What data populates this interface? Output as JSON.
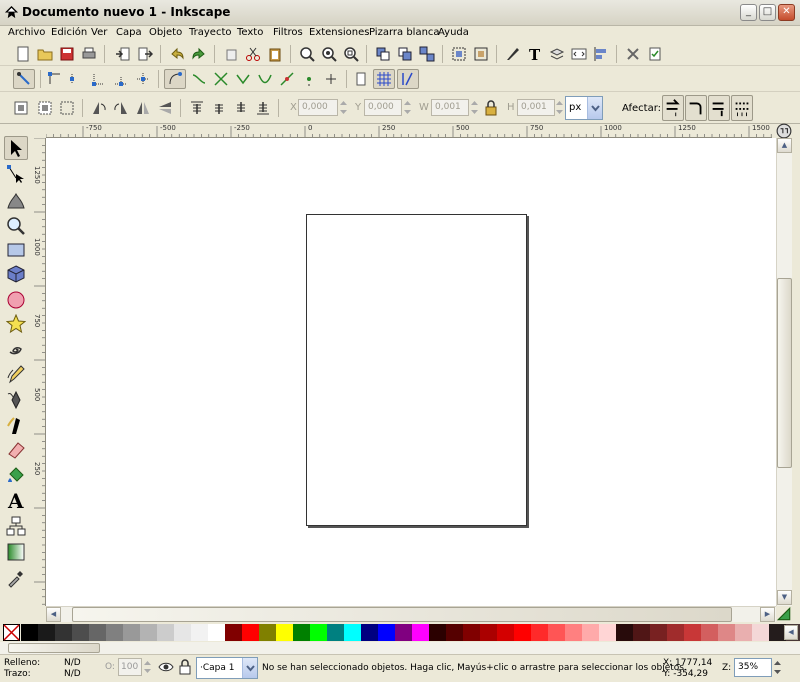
{
  "window": {
    "title": "Documento nuevo 1 - Inkscape",
    "buttons": {
      "minimize": "_",
      "maximize": "□",
      "close": "✕"
    }
  },
  "menubar": {
    "items": [
      "Archivo",
      "Edición",
      "Ver",
      "Capa",
      "Objeto",
      "Trayecto",
      "Texto",
      "Filtros",
      "Extensiones",
      "Pizarra blanca",
      "Ayuda"
    ]
  },
  "toolbar_main": {
    "icons": [
      "new-doc-icon",
      "open-icon",
      "save-icon",
      "print-icon",
      "import-icon",
      "export-icon",
      "undo-icon",
      "redo-icon",
      "duplicate-icon",
      "cut-icon",
      "paste-icon",
      "zoom-selection-icon",
      "zoom-drawing-icon",
      "zoom-page-icon",
      "clone-icon",
      "group-icon",
      "ungroup-icon",
      "fill-stroke-icon",
      "text-font-icon",
      "layers-icon",
      "xml-editor-icon",
      "align-icon",
      "preferences-icon",
      "document-properties-icon"
    ]
  },
  "toolbar_snap": {
    "icons": [
      "snap-toggle-icon",
      "snap-bbox-icon",
      "snap-edges-icon",
      "snap-corners-icon",
      "snap-midpoints-icon",
      "snap-center-icon",
      "snap-nodes-icon",
      "snap-paths-icon",
      "snap-intersections-icon",
      "snap-cusp-icon",
      "snap-smooth-icon",
      "snap-midpoints-path-icon",
      "snap-object-center-icon",
      "snap-rotation-icon",
      "snap-page-icon",
      "snap-grid-icon",
      "snap-guide-icon"
    ]
  },
  "toolbar_tool": {
    "x_label": "X",
    "x_value": "0,000",
    "y_label": "Y",
    "y_value": "0,000",
    "w_label": "W",
    "w_value": "0,001",
    "h_label": "H",
    "h_value": "0,001",
    "unit": "px",
    "affect_label": "Afectar:"
  },
  "tools": [
    "selector-tool-icon",
    "node-tool-icon",
    "tweak-tool-icon",
    "zoom-tool-icon",
    "rectangle-tool-icon",
    "3d-box-tool-icon",
    "ellipse-tool-icon",
    "star-tool-icon",
    "spiral-tool-icon",
    "pencil-tool-icon",
    "pen-tool-icon",
    "calligraphy-tool-icon",
    "eraser-tool-icon",
    "paint-bucket-tool-icon",
    "text-tool-icon",
    "connector-tool-icon",
    "gradient-tool-icon",
    "dropper-tool-icon"
  ],
  "ruler": {
    "h_labels": [
      "-750",
      "-500",
      "-250",
      "0",
      "250",
      "500",
      "750",
      "1000",
      "1250",
      "1500"
    ],
    "v_labels": [
      "1250",
      "1000",
      "750",
      "500",
      "250"
    ]
  },
  "palette": {
    "colors": [
      "#000000",
      "#1a1a1a",
      "#333333",
      "#4d4d4d",
      "#666666",
      "#808080",
      "#999999",
      "#b3b3b3",
      "#cccccc",
      "#e6e6e6",
      "#f2f2f2",
      "#ffffff",
      "#800000",
      "#ff0000",
      "#808000",
      "#ffff00",
      "#008000",
      "#00ff00",
      "#008080",
      "#00ffff",
      "#000080",
      "#0000ff",
      "#800080",
      "#ff00ff",
      "#2b0000",
      "#550000",
      "#800000",
      "#aa0000",
      "#d40000",
      "#ff0000",
      "#ff2a2a",
      "#ff5555",
      "#ff8080",
      "#ffaaaa",
      "#ffd5d5",
      "#280b0b",
      "#501616",
      "#782121",
      "#a02c2c",
      "#c83737",
      "#d35f5f",
      "#de8787",
      "#e9afaf",
      "#f4d7d7",
      "#241c1c",
      "#483737"
    ]
  },
  "status": {
    "fill_label": "Relleno:",
    "fill_value": "N/D",
    "stroke_label": "Trazo:",
    "stroke_value": "N/D",
    "opacity_label": "O:",
    "opacity_value": "100",
    "layer": "·Capa 1",
    "message": "No se han seleccionado objetos. Haga clic, Mayús+clic o arrastre para seleccionar los objetos.",
    "coord_x": "X: 1777,14",
    "coord_y": "Y: -354,29",
    "zoom_label": "Z:",
    "zoom_value": "35%"
  }
}
